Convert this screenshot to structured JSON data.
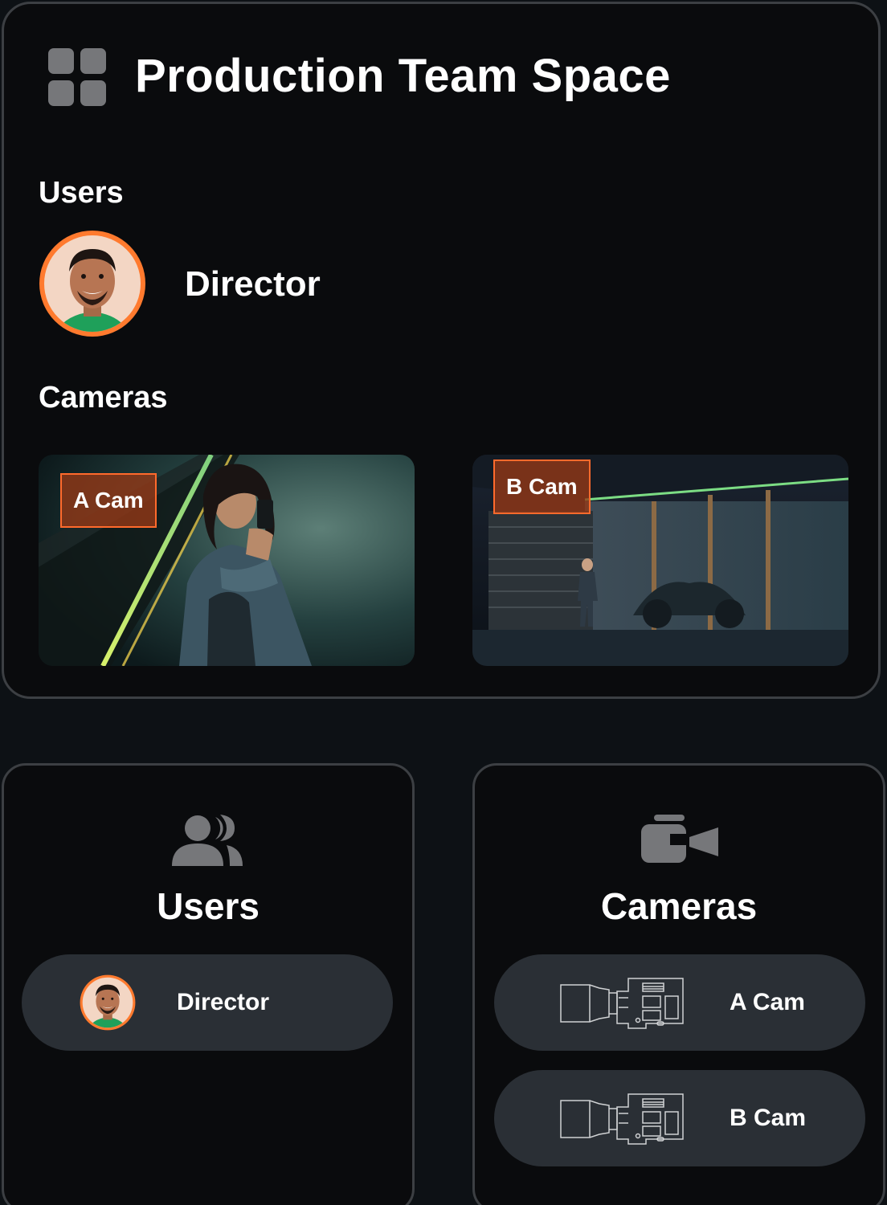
{
  "space": {
    "title": "Production Team Space",
    "users_label": "Users",
    "cameras_label": "Cameras",
    "icon": "grid-icon",
    "users": [
      {
        "name": "Director",
        "avatar": "director-avatar"
      }
    ],
    "cameras": [
      {
        "name": "A Cam",
        "preview": "woman-with-phone"
      },
      {
        "name": "B Cam",
        "preview": "person-at-garage-at-night"
      }
    ]
  },
  "users_panel": {
    "title": "Users",
    "icon": "users-icon",
    "items": [
      {
        "name": "Director"
      }
    ]
  },
  "cameras_panel": {
    "title": "Cameras",
    "icon": "video-camera-icon",
    "items": [
      {
        "name": "A Cam"
      },
      {
        "name": "B Cam"
      }
    ]
  },
  "colors": {
    "accent": "#ff6a2c",
    "card_border": "#3c3f43",
    "pill_bg": "#2a2f35",
    "background": "#0d1115"
  }
}
